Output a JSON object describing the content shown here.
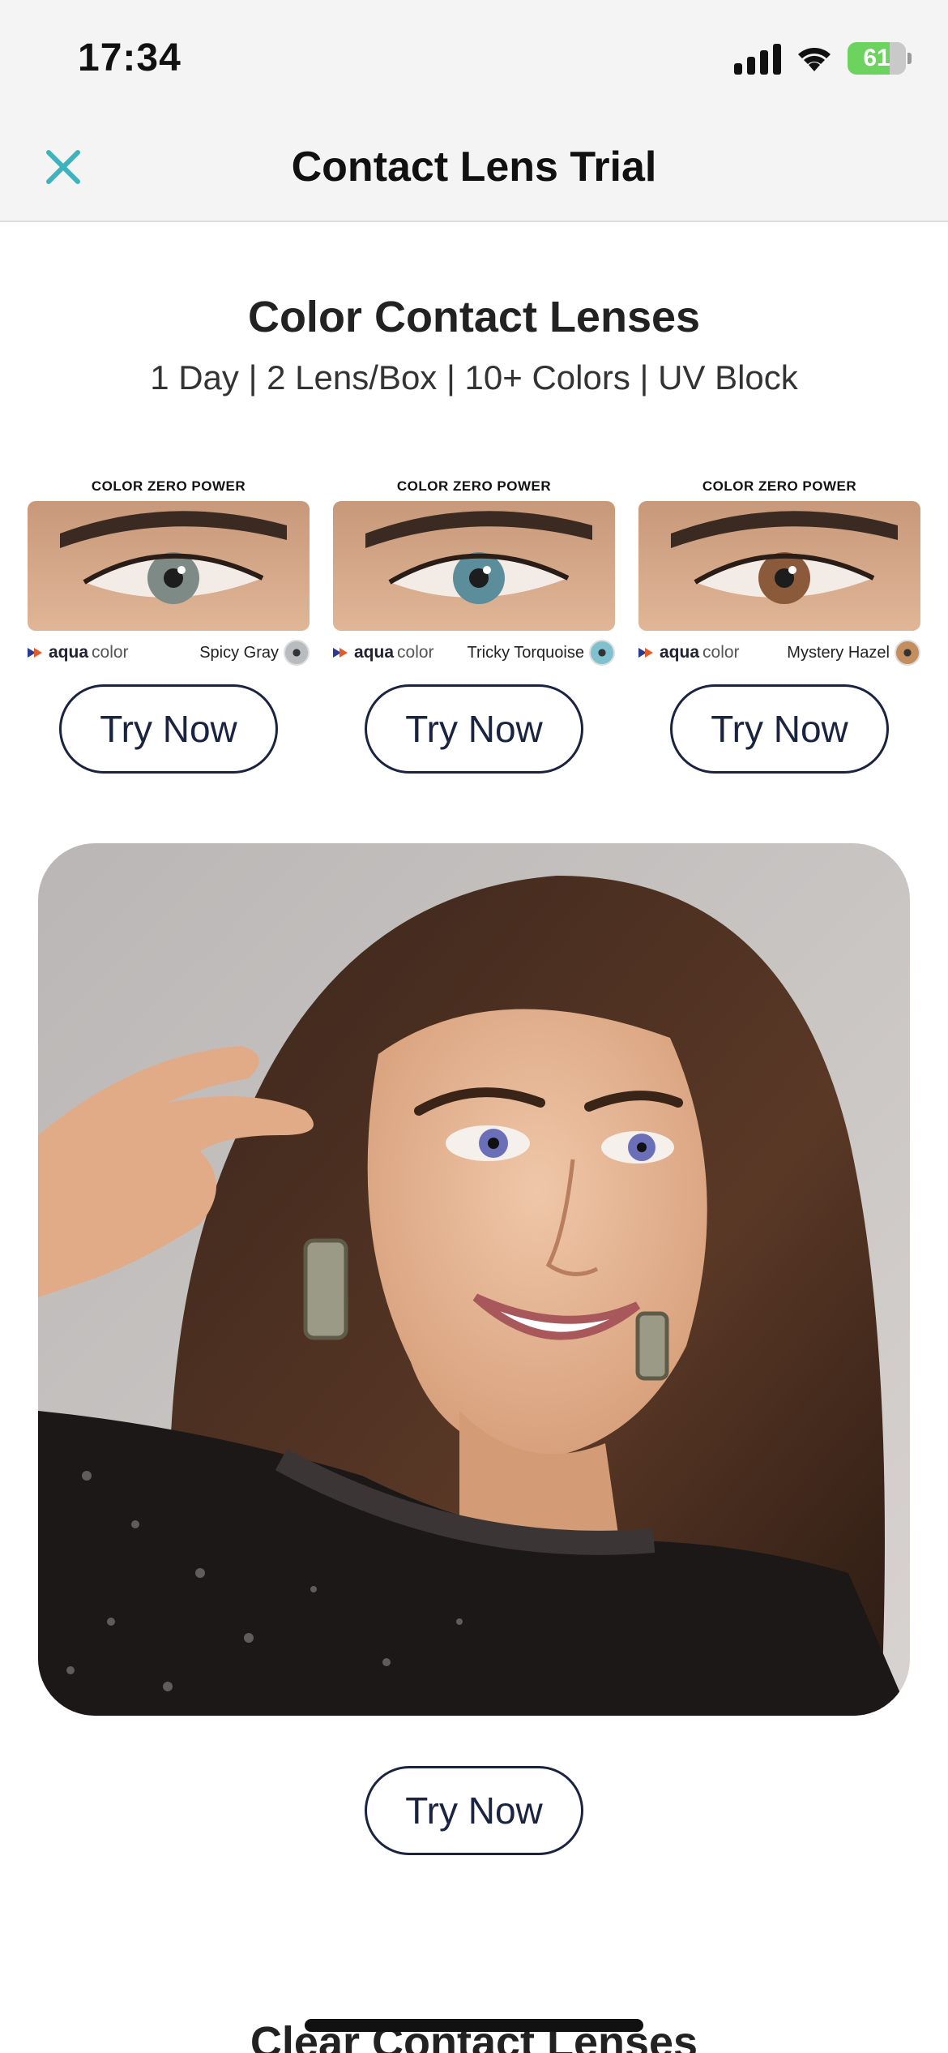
{
  "status_bar": {
    "time": "17:34",
    "battery": "61",
    "icons": [
      "signal-icon",
      "wifi-icon",
      "battery-icon"
    ]
  },
  "nav": {
    "title": "Contact Lens Trial",
    "close_icon": "close-icon",
    "accent_color": "#3fb3bd"
  },
  "section": {
    "title": "Color Contact Lenses",
    "subtitle": "1 Day | 2 Lens/Box | 10+ Colors | UV Block"
  },
  "products": [
    {
      "label": "COLOR ZERO POWER",
      "brand_a": "aqua",
      "brand_b": "color",
      "shade": "Spicy Gray",
      "iris_color": "#7d8a85",
      "swatch_color": "#b9bcbf",
      "button": "Try Now"
    },
    {
      "label": "COLOR ZERO POWER",
      "brand_a": "aqua",
      "brand_b": "color",
      "shade": "Tricky Torquoise",
      "iris_color": "#5c8d9a",
      "swatch_color": "#7fc1cf",
      "button": "Try Now"
    },
    {
      "label": "COLOR ZERO POWER",
      "brand_a": "aqua",
      "brand_b": "color",
      "shade": "Mystery Hazel",
      "iris_color": "#8a5a3a",
      "swatch_color": "#c58e5f",
      "button": "Try Now"
    }
  ],
  "hero": {
    "button": "Try Now"
  },
  "next_section": {
    "title": "Clear Contact Lenses"
  },
  "colors": {
    "button_border": "#1a2340",
    "header_bg": "#f4f4f4"
  }
}
